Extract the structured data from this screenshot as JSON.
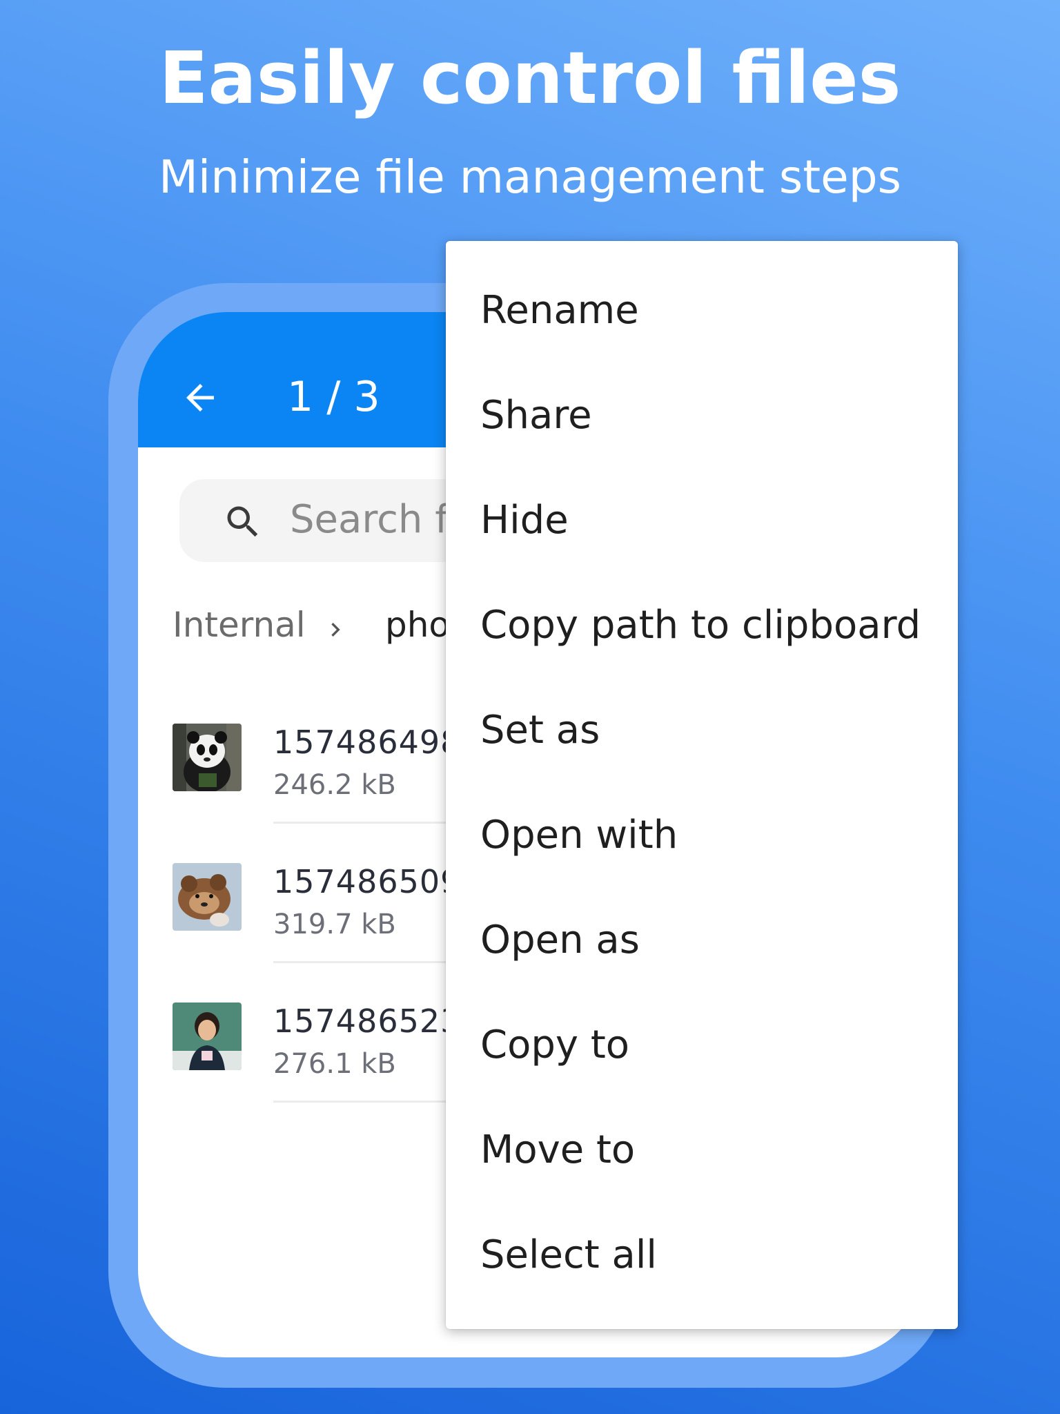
{
  "promo": {
    "headline": "Easily control files",
    "subline": "Minimize file management steps"
  },
  "appbar": {
    "counter": "1 / 3",
    "color": "#0b85f3",
    "back_icon": "arrow-left-icon"
  },
  "search": {
    "placeholder": "Search f",
    "icon": "search-icon"
  },
  "breadcrumb": {
    "root": "Internal",
    "current": "pho"
  },
  "files": [
    {
      "name": "157486498",
      "size": "246.2 kB",
      "thumbnail": "panda-photo"
    },
    {
      "name": "157486509",
      "size": "319.7 kB",
      "thumbnail": "red-panda-photo"
    },
    {
      "name": "157486523",
      "size": "276.1 kB",
      "thumbnail": "child-portrait-photo"
    }
  ],
  "menu": {
    "items": [
      {
        "label": "Rename"
      },
      {
        "label": "Share"
      },
      {
        "label": "Hide"
      },
      {
        "label": "Copy path to clipboard"
      },
      {
        "label": "Set as"
      },
      {
        "label": "Open with"
      },
      {
        "label": "Open as"
      },
      {
        "label": "Copy to"
      },
      {
        "label": "Move to"
      },
      {
        "label": "Select all"
      }
    ]
  }
}
